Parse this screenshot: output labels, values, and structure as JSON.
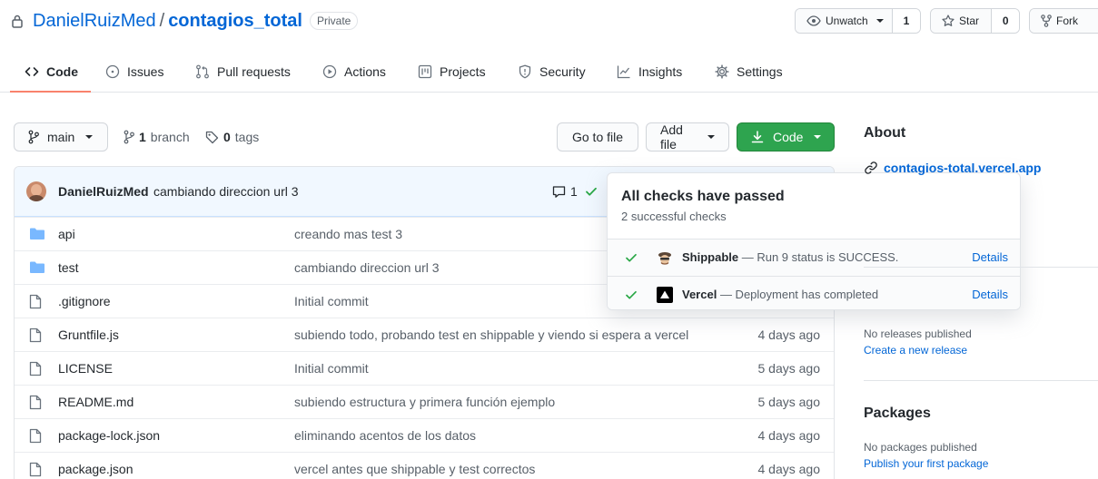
{
  "repo": {
    "owner": "DanielRuizMed",
    "separator": "/",
    "name": "contagios_total",
    "visibility": "Private"
  },
  "actions": {
    "watch_label": "Unwatch",
    "watch_count": "1",
    "star_label": "Star",
    "star_count": "0",
    "fork_label": "Fork"
  },
  "nav": {
    "tabs": [
      {
        "label": "Code",
        "icon": "code-icon"
      },
      {
        "label": "Issues",
        "icon": "issue-icon"
      },
      {
        "label": "Pull requests",
        "icon": "pull-request-icon"
      },
      {
        "label": "Actions",
        "icon": "play-icon"
      },
      {
        "label": "Projects",
        "icon": "project-icon"
      },
      {
        "label": "Security",
        "icon": "shield-icon"
      },
      {
        "label": "Insights",
        "icon": "graph-icon"
      },
      {
        "label": "Settings",
        "icon": "gear-icon"
      }
    ],
    "active_tab": "Code",
    "accent": "#f9826c"
  },
  "toolbar": {
    "branch": "main",
    "branch_count": "1",
    "branch_word": "branch",
    "tag_count": "0",
    "tag_word": "tags",
    "go_to_file": "Go to file",
    "add_file": "Add file",
    "code": "Code"
  },
  "commit": {
    "author": "DanielRuizMed",
    "message": "cambiando direccion url 3",
    "comments": "1"
  },
  "files": [
    {
      "type": "dir",
      "name": "api",
      "message": "creando mas test 3",
      "age": ""
    },
    {
      "type": "dir",
      "name": "test",
      "message": "cambiando direccion url 3",
      "age": ""
    },
    {
      "type": "file",
      "name": ".gitignore",
      "message": "Initial commit",
      "age": ""
    },
    {
      "type": "file",
      "name": "Gruntfile.js",
      "message": "subiendo todo, probando test en shippable y viendo si espera a vercel",
      "age": "4 days ago"
    },
    {
      "type": "file",
      "name": "LICENSE",
      "message": "Initial commit",
      "age": "5 days ago"
    },
    {
      "type": "file",
      "name": "README.md",
      "message": "subiendo estructura y primera función ejemplo",
      "age": "5 days ago"
    },
    {
      "type": "file",
      "name": "package-lock.json",
      "message": "eliminando acentos de los datos",
      "age": "4 days ago"
    },
    {
      "type": "file",
      "name": "package.json",
      "message": "vercel antes que shippable y test correctos",
      "age": "4 days ago"
    }
  ],
  "checks": {
    "title": "All checks have passed",
    "subtitle": "2 successful checks",
    "items": [
      {
        "name": "Shippable",
        "description": " — Run 9 status is SUCCESS.",
        "link": "Details"
      },
      {
        "name": "Vercel",
        "description": " — Deployment has completed",
        "link": "Details"
      }
    ],
    "success_color": "#28a745"
  },
  "sidebar": {
    "about_title": "About",
    "website": "contagios-total.vercel.app",
    "releases_text": "No releases published",
    "releases_link": "Create a new release",
    "packages_title": "Packages",
    "packages_text": "No packages published",
    "packages_link": "Publish your first package"
  },
  "colors": {
    "link": "#0366d6",
    "primary_button": "#2ea44f",
    "folder": "#79b8ff"
  }
}
